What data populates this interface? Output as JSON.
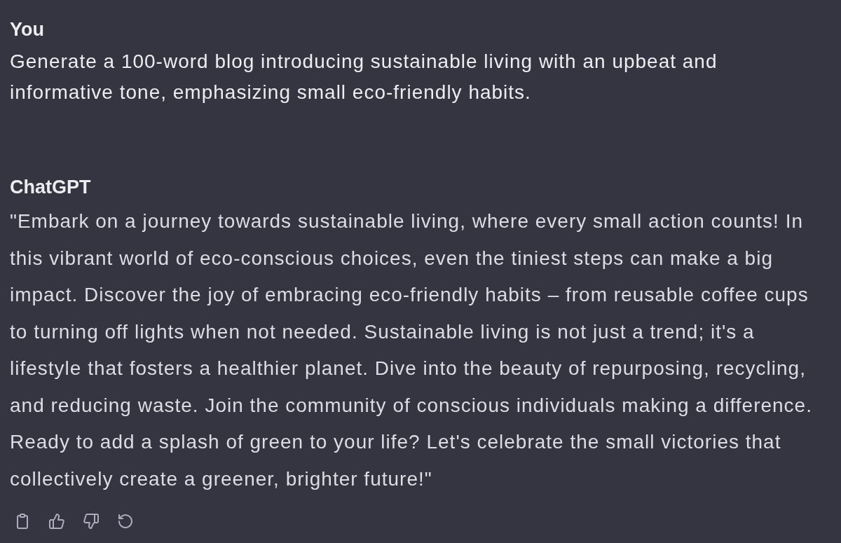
{
  "messages": [
    {
      "kind": "user",
      "author": "You",
      "text": "Generate a 100-word blog introducing sustainable living with an upbeat and informative tone, emphasizing small eco-friendly habits."
    },
    {
      "kind": "assistant",
      "author": "ChatGPT",
      "text": "\"Embark on a journey towards sustainable living, where every small action counts! In this vibrant world of eco-conscious choices, even the tiniest steps can make a big impact. Discover the joy of embracing eco-friendly habits – from reusable coffee cups to turning off lights when not needed. Sustainable living is not just a trend; it's a lifestyle that fosters a healthier planet. Dive into the beauty of repurposing, recycling, and reducing waste. Join the community of conscious individuals making a difference. Ready to add a splash of green to your life? Let's celebrate the small victories that collectively create a greener, brighter future!\""
    }
  ]
}
